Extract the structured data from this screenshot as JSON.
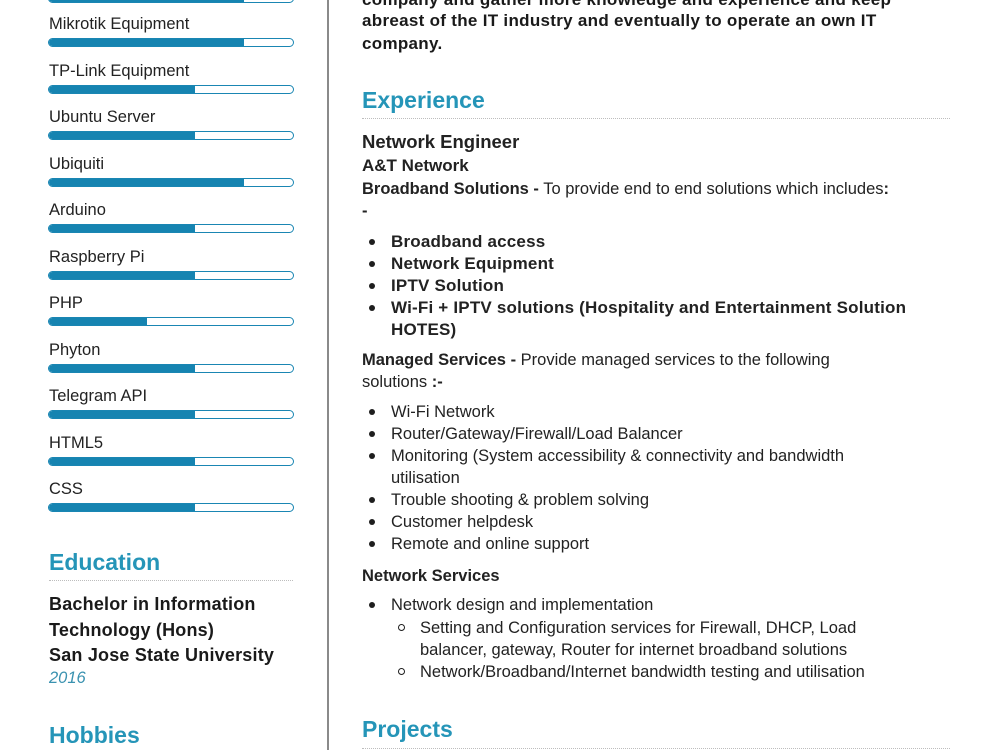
{
  "sidebar": {
    "skills": [
      {
        "label": "Mikrotik Equipment",
        "level_percent": 80
      },
      {
        "label": "TP-Link Equipment",
        "level_percent": 60
      },
      {
        "label": "Ubuntu Server",
        "level_percent": 60
      },
      {
        "label": "Ubiquiti",
        "level_percent": 80
      },
      {
        "label": "Arduino",
        "level_percent": 60
      },
      {
        "label": "Raspberry Pi",
        "level_percent": 60
      },
      {
        "label": "PHP",
        "level_percent": 40
      },
      {
        "label": "Phyton",
        "level_percent": 60
      },
      {
        "label": "Telegram API",
        "level_percent": 60
      },
      {
        "label": "HTML5",
        "level_percent": 60
      },
      {
        "label": "CSS",
        "level_percent": 60
      }
    ],
    "education": {
      "heading": "Education",
      "degree_line1": "Bachelor in Information",
      "degree_line2": "Technology (Hons)",
      "school": "San Jose State University",
      "year": "2016"
    },
    "hobbies": {
      "heading": "Hobbies"
    }
  },
  "main": {
    "objective_lines": [
      "company and gather more knowledge and experience and keep",
      "abreast of the IT industry and eventually to operate an own IT",
      "company."
    ],
    "experience": {
      "heading": "Experience",
      "title": "Network Engineer",
      "company": "A&T Network",
      "broadband": {
        "label": "Broadband Solutions -",
        "text": " To provide end to end solutions which includes",
        "suffix": ":",
        "dash": "-",
        "items": [
          "Broadband access",
          "Network Equipment",
          "IPTV Solution",
          "Wi-Fi + IPTV solutions (Hospitality and Entertainment Solution",
          "HOTES)"
        ]
      },
      "managed": {
        "label": "Managed Services -",
        "text": " Provide managed services to the following",
        "line2": "solutions ",
        "line2_suffix": ":-",
        "items": [
          "Wi-Fi Network",
          "Router/Gateway/Firewall/Load Balancer",
          "Monitoring (System accessibility & connectivity and bandwidth",
          "utilisation",
          "Trouble shooting & problem solving",
          "Customer helpdesk",
          "Remote and online support"
        ]
      },
      "network_services": {
        "label": "Network Services",
        "item": "Network design and implementation",
        "sub_items": [
          "Setting and Configuration services for Firewall, DHCP, Load",
          "balancer, gateway, Router for internet broadband solutions",
          "Network/Broadband/Internet bandwidth testing and utilisation"
        ]
      }
    },
    "projects": {
      "heading": "Projects"
    }
  },
  "colors": {
    "accent": "#2595b8",
    "bar_fill": "#1684b1"
  }
}
